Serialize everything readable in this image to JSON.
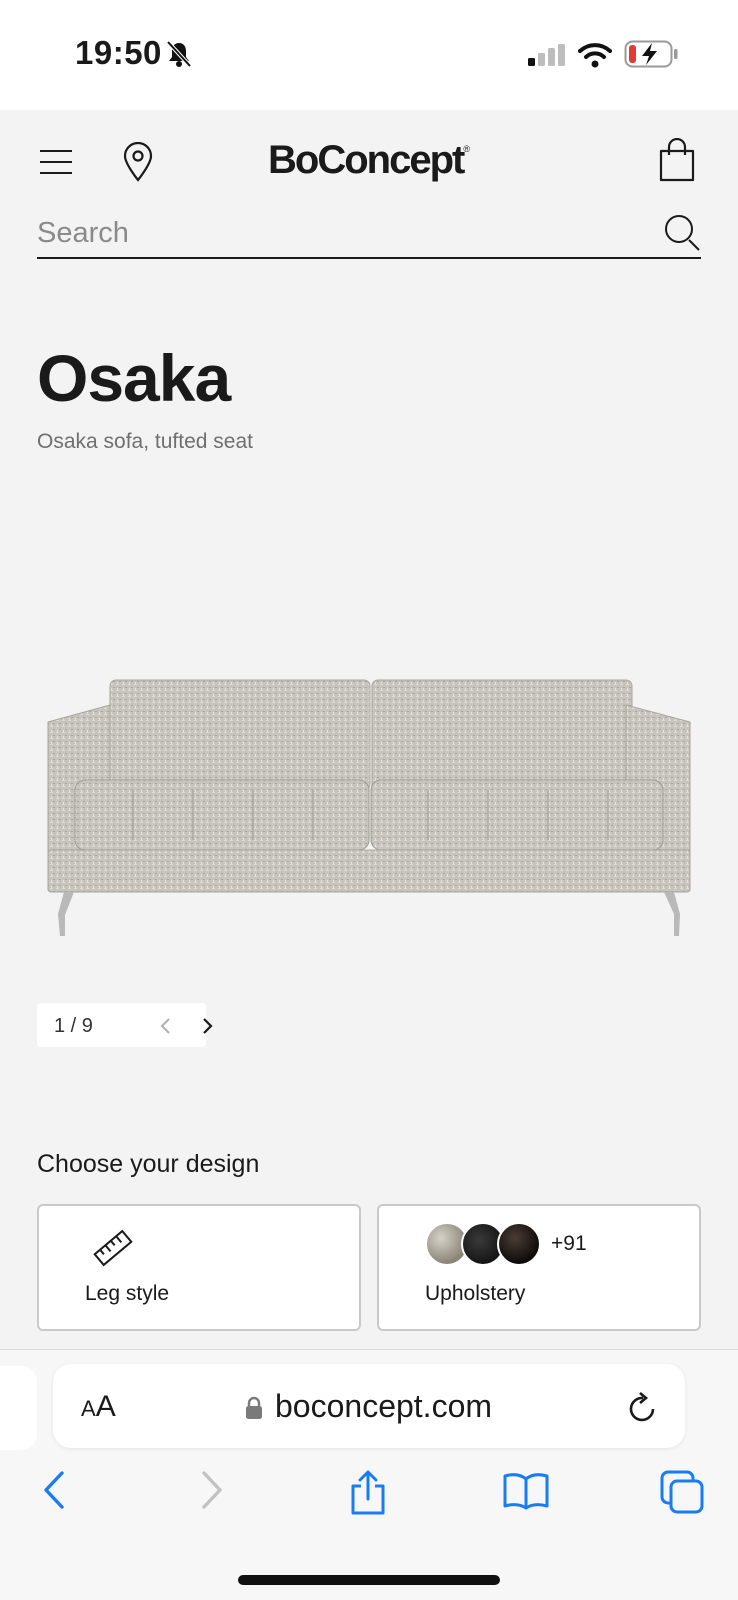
{
  "status": {
    "time": "19:50"
  },
  "header": {
    "logo": "BoConcept",
    "logo_mark": "®",
    "search_placeholder": "Search"
  },
  "product": {
    "title": "Osaka",
    "subtitle": "Osaka sofa, tufted seat",
    "image_index": 1,
    "image_total": 9,
    "pager_text": "1 / 9"
  },
  "design": {
    "heading": "Choose your design",
    "options": [
      {
        "label": "Leg style",
        "icon": "ruler-icon"
      },
      {
        "label": "Upholstery",
        "more": "+91"
      }
    ]
  },
  "browser": {
    "aa": "AA",
    "url": "boconcept.com"
  },
  "colors": {
    "page_bg": "#f3f3f3",
    "text": "#1a1a1a",
    "safari_blue": "#1a7cf5"
  }
}
